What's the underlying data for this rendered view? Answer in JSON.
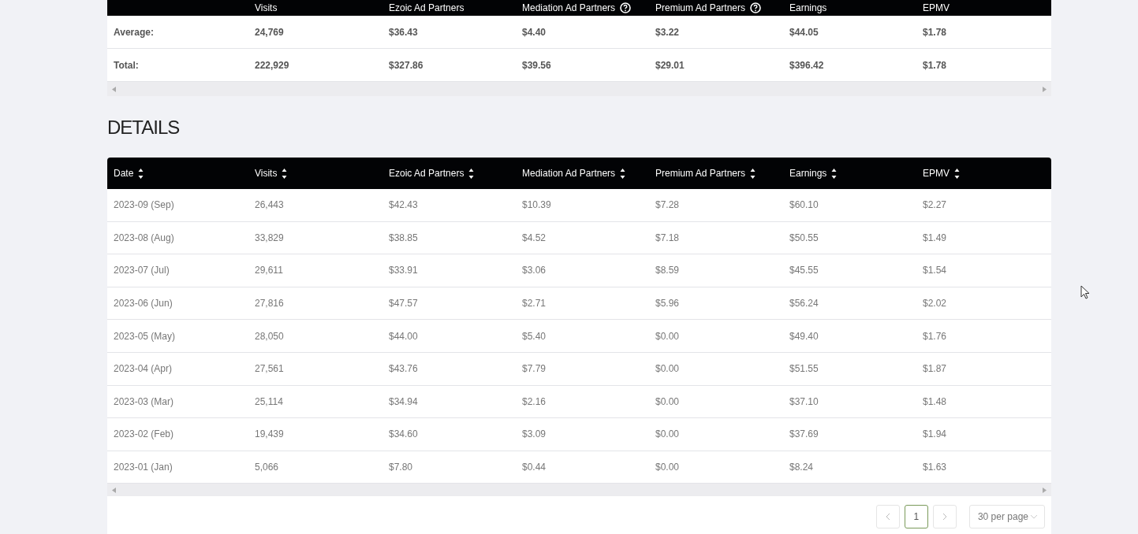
{
  "summary": {
    "columns": [
      {
        "label": "Visits",
        "info": false
      },
      {
        "label": "Ezoic Ad Partners",
        "info": false
      },
      {
        "label": "Mediation Ad Partners",
        "info": true
      },
      {
        "label": "Premium Ad Partners",
        "info": true
      },
      {
        "label": "Earnings",
        "info": false
      },
      {
        "label": "EPMV",
        "info": false
      }
    ],
    "rows": [
      {
        "label": "Average:",
        "cells": [
          "24,769",
          "$36.43",
          "$4.40",
          "$3.22",
          "$44.05",
          "$1.78"
        ]
      },
      {
        "label": "Total:",
        "cells": [
          "222,929",
          "$327.86",
          "$39.56",
          "$29.01",
          "$396.42",
          "$1.78"
        ]
      }
    ]
  },
  "details": {
    "title": "DETAILS",
    "columns": [
      {
        "label": "Date",
        "sortable": true
      },
      {
        "label": "Visits",
        "sortable": true
      },
      {
        "label": "Ezoic Ad Partners",
        "sortable": true
      },
      {
        "label": "Mediation Ad Partners",
        "sortable": true
      },
      {
        "label": "Premium Ad Partners",
        "sortable": true
      },
      {
        "label": "Earnings",
        "sortable": true
      },
      {
        "label": "EPMV",
        "sortable": true
      }
    ],
    "rows": [
      [
        "2023-09 (Sep)",
        "26,443",
        "$42.43",
        "$10.39",
        "$7.28",
        "$60.10",
        "$2.27"
      ],
      [
        "2023-08 (Aug)",
        "33,829",
        "$38.85",
        "$4.52",
        "$7.18",
        "$50.55",
        "$1.49"
      ],
      [
        "2023-07 (Jul)",
        "29,611",
        "$33.91",
        "$3.06",
        "$8.59",
        "$45.55",
        "$1.54"
      ],
      [
        "2023-06 (Jun)",
        "27,816",
        "$47.57",
        "$2.71",
        "$5.96",
        "$56.24",
        "$2.02"
      ],
      [
        "2023-05 (May)",
        "28,050",
        "$44.00",
        "$5.40",
        "$0.00",
        "$49.40",
        "$1.76"
      ],
      [
        "2023-04 (Apr)",
        "27,561",
        "$43.76",
        "$7.79",
        "$0.00",
        "$51.55",
        "$1.87"
      ],
      [
        "2023-03 (Mar)",
        "25,114",
        "$34.94",
        "$2.16",
        "$0.00",
        "$37.10",
        "$1.48"
      ],
      [
        "2023-02 (Feb)",
        "19,439",
        "$34.60",
        "$3.09",
        "$0.00",
        "$37.69",
        "$1.94"
      ],
      [
        "2023-01 (Jan)",
        "5,066",
        "$7.80",
        "$0.44",
        "$0.00",
        "$8.24",
        "$1.63"
      ]
    ]
  },
  "pagination": {
    "pages": [
      {
        "label": "1",
        "selected": true
      }
    ],
    "per_page": "30 per page"
  }
}
